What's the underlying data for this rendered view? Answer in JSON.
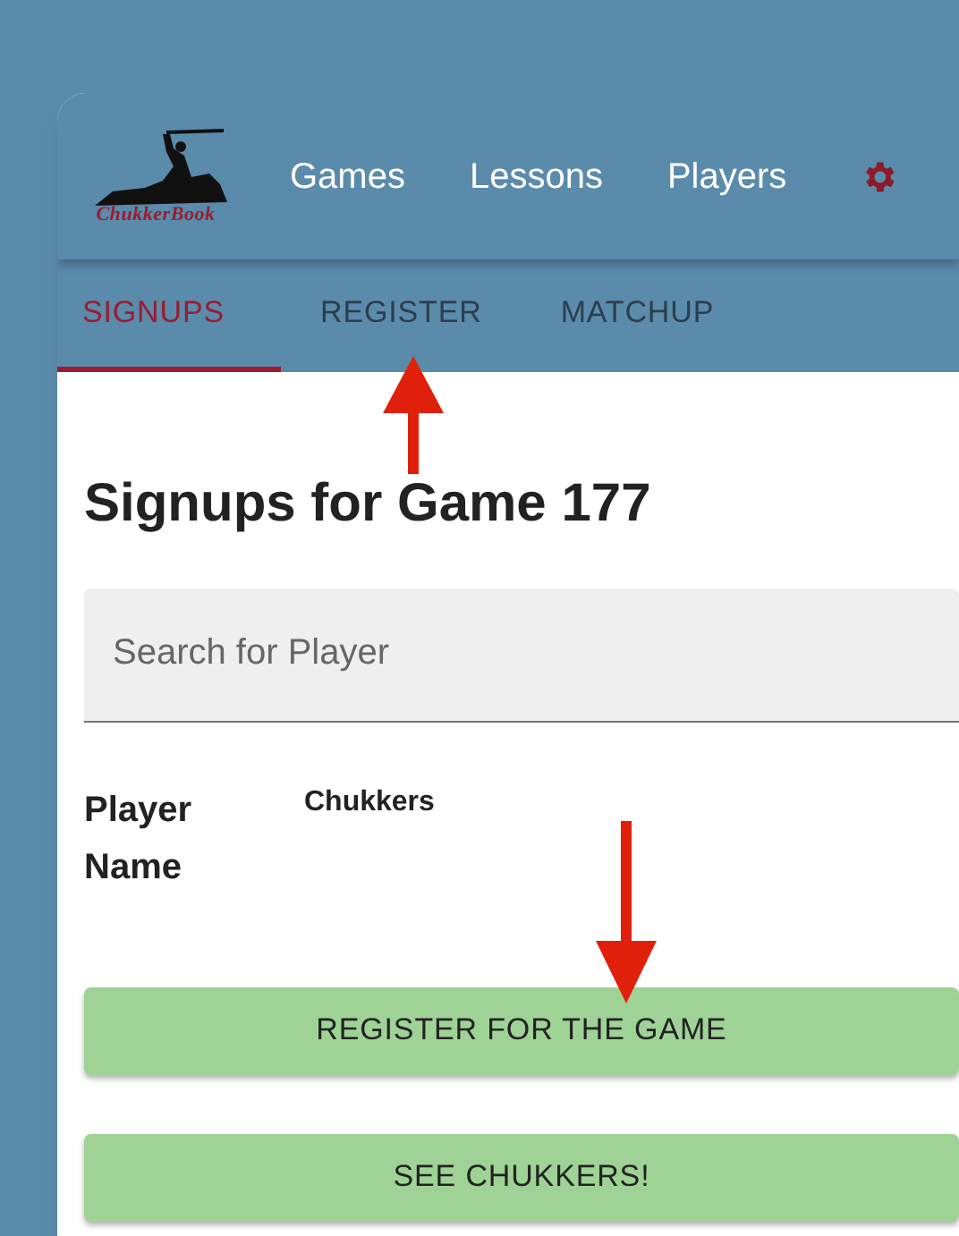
{
  "logo": {
    "text": "ChukkerBook"
  },
  "nav": [
    {
      "label": "Games"
    },
    {
      "label": "Lessons"
    },
    {
      "label": "Players"
    }
  ],
  "tabs": [
    {
      "label": "SIGNUPS",
      "selected": true
    },
    {
      "label": "REGISTER",
      "selected": false
    },
    {
      "label": "MATCHUP",
      "selected": false
    }
  ],
  "heading": "Signups for Game 177",
  "search": {
    "placeholder": "Search for Player"
  },
  "table": {
    "columns": [
      "Player Name",
      "Chukkers"
    ]
  },
  "buttons": [
    "REGISTER FOR THE GAME",
    "SEE CHUKKERS!"
  ]
}
